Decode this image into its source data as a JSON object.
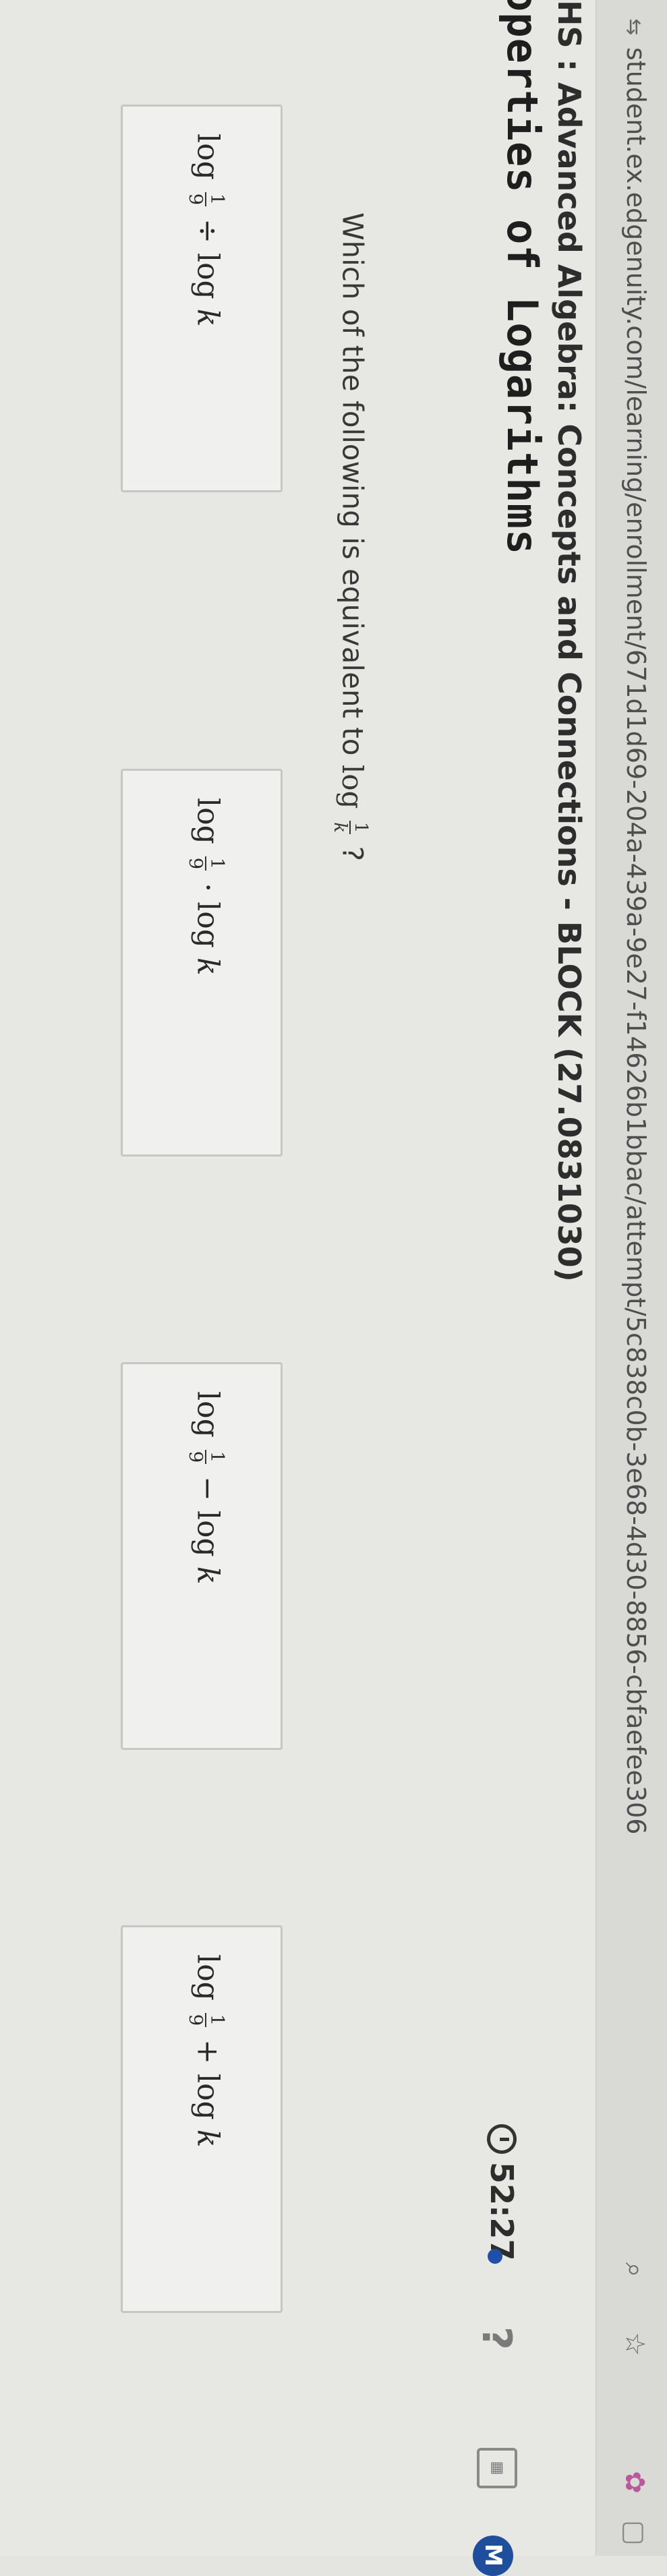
{
  "browser": {
    "url": "student.ex.edgenuity.com/learning/enrollment/671d1d69-204a-439a-9e27-f14626b1bbac/attempt/5c838c0b-3e68-4d30-8856-cbfaefee306",
    "url_icon": "tune-icon",
    "zoom_icon": "zoom-icon",
    "star_icon": "star-icon"
  },
  "course": {
    "title": "HS : Advanced Algebra: Concepts and Connections - BLOCK (27.0831030)",
    "lesson": "operties of Logarithms"
  },
  "toolbar": {
    "timer": "52:27",
    "menu_badge": "M"
  },
  "question": {
    "prefix": "Which of the following is equivalent to",
    "log": "log",
    "num": "1",
    "den": "k",
    "suffix": "?"
  },
  "choices": [
    {
      "log1": "log",
      "num": "1",
      "den": "9",
      "op": "÷",
      "log2": "log",
      "var": "k"
    },
    {
      "log1": "log",
      "num": "1",
      "den": "9",
      "op": "·",
      "log2": "log",
      "var": "k"
    },
    {
      "log1": "log",
      "num": "1",
      "den": "9",
      "op": "−",
      "log2": "log",
      "var": "k"
    },
    {
      "log1": "log",
      "num": "1",
      "den": "9",
      "op": "+",
      "log2": "log",
      "var": "k"
    }
  ],
  "colors": {
    "accent": "#1f4f9c",
    "background": "#e7e7e4"
  }
}
